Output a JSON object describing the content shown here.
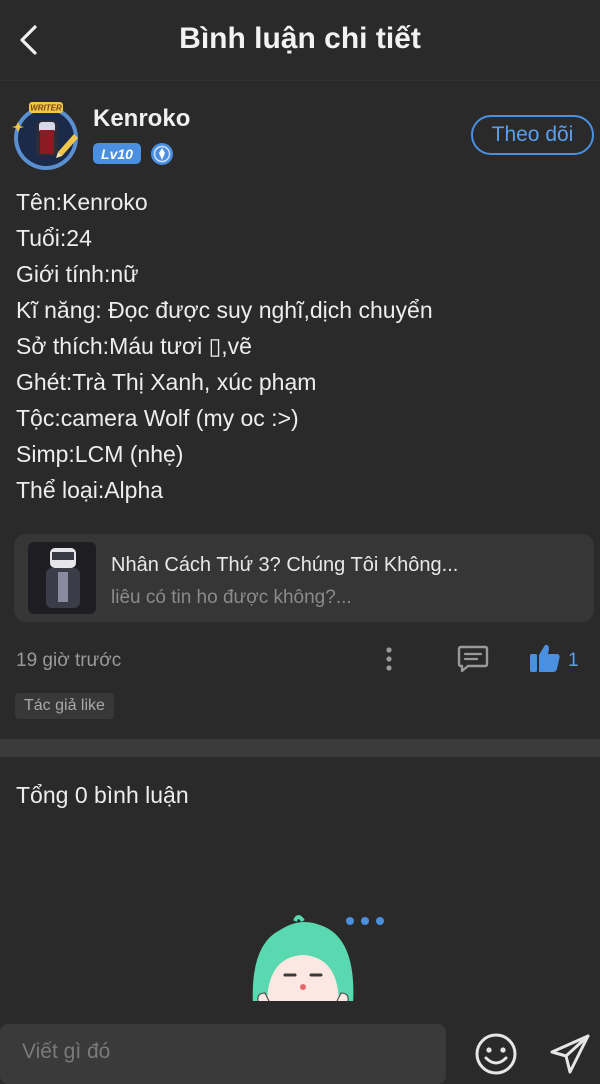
{
  "header": {
    "title": "Bình luận chi tiết"
  },
  "author": {
    "name": "Kenroko",
    "level_badge": "Lv10",
    "avatar_frame_text": "WRITER",
    "follow_label": "Theo dõi"
  },
  "post": {
    "lines": [
      "Tên:Kenroko",
      "Tuổi:24",
      "Giới tính:nữ",
      "Kĩ năng: Đọc được suy nghĩ,dịch chuyển",
      "Sở thích:Máu tươi ▯,vẽ",
      "Ghét:Trà Thị Xanh, xúc phạm",
      "Tộc:camera Wolf (my oc :>)",
      "Simp:LCM (nhẹ)",
      "Thể loại:Alpha"
    ]
  },
  "reference": {
    "title": "Nhân Cách Thứ 3? Chúng Tôi Không...",
    "subtitle": "liêu có tin ho được không?..."
  },
  "meta": {
    "time": "19 giờ trước",
    "like_count": "1",
    "author_tag": "Tác giả like"
  },
  "comments": {
    "total_label": "Tổng 0 bình luận"
  },
  "input": {
    "placeholder": "Viết gì đó"
  },
  "colors": {
    "accent": "#4a8fe0",
    "background": "#2a2a2a",
    "card": "#363636"
  },
  "icons": {
    "back": "chevron-left-icon",
    "verify": "verified-badge-icon",
    "more": "more-vertical-icon",
    "comment": "comment-icon",
    "like": "thumbs-up-icon",
    "emoji": "emoji-icon",
    "send": "send-icon"
  }
}
